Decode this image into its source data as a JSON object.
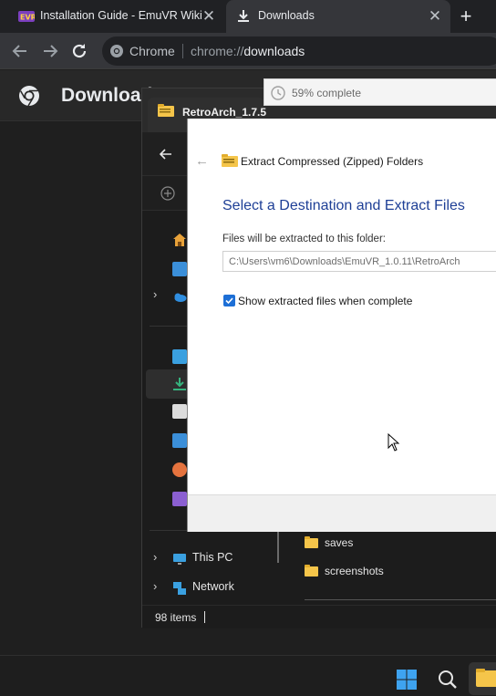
{
  "browser": {
    "tabs": [
      {
        "label": "Installation Guide - EmuVR Wiki",
        "icon": "emuvr-favicon-icon"
      },
      {
        "label": "Downloads",
        "icon": "download-icon"
      }
    ],
    "new_tab_label": "+",
    "tab_close_label": "✕",
    "omnibox": {
      "scheme_label": "Chrome",
      "url_prefix": "chrome://",
      "url_host": "downloads"
    }
  },
  "downloads_page": {
    "title": "Downloads"
  },
  "download_progress": {
    "text": "59% complete",
    "percent": 59
  },
  "explorer": {
    "tab_title": "RetroArch_1.7.5",
    "sidebar": {
      "this_pc": "This PC",
      "network": "Network",
      "chevron": "›"
    },
    "folders": [
      "saves",
      "screenshots"
    ],
    "status": "98 items"
  },
  "extract_dialog": {
    "back_glyph": "←",
    "breadcrumb": "Extract Compressed (Zipped) Folders",
    "heading": "Select a Destination and Extract Files",
    "destination_label": "Files will be extracted to this folder:",
    "destination_path": "C:\\Users\\vm6\\Downloads\\EmuVR_1.0.11\\RetroArch",
    "show_files_label": "Show extracted files when complete",
    "show_files_checked": true
  },
  "colors": {
    "accent_blue": "#1e3f96",
    "checkbox_blue": "#1d6fd6",
    "folder_yellow": "#f5c54a"
  }
}
